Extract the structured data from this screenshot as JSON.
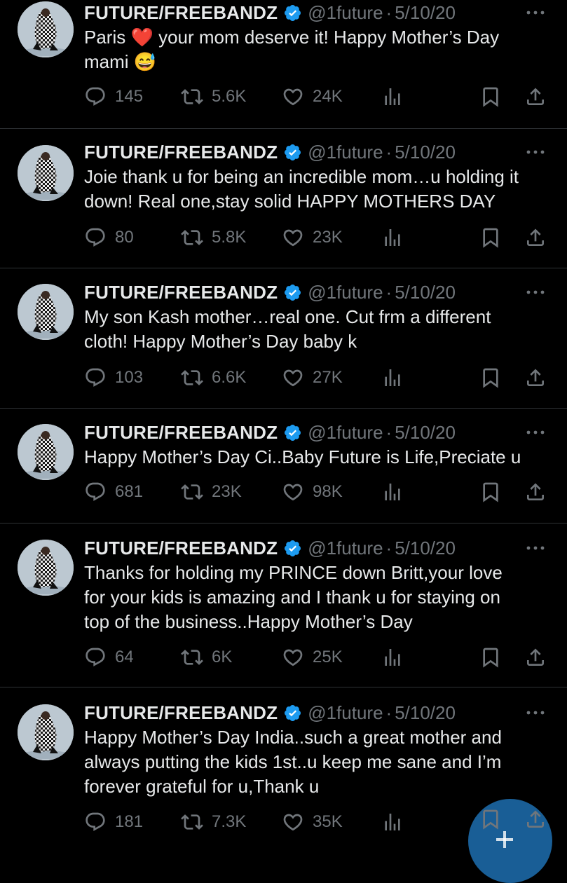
{
  "colors": {
    "background": "#000000",
    "text": "#e7e9ea",
    "muted": "#71767b",
    "verified": "#1d9bf0",
    "divider": "#2f3336",
    "fab": "#1d6fb0"
  },
  "tweets": [
    {
      "name": "FUTURE/FREEBANDZ",
      "handle": "@1future",
      "sep": "·",
      "date": "5/10/20",
      "lines": [
        "Paris",
        "mami"
      ],
      "paris_rest": " your mom deserve it! Happy Mother’s Day",
      "emoji_after_mami": "😅",
      "replies": "145",
      "reposts": "5.6K",
      "likes": "24K"
    },
    {
      "name": "FUTURE/FREEBANDZ",
      "handle": "@1future",
      "sep": "·",
      "date": "5/10/20",
      "lines": [
        "Joie thank u for being an incredible mom…u holding it",
        "down! Real one,stay solid HAPPY MOTHERS DAY"
      ],
      "replies": "80",
      "reposts": "5.8K",
      "likes": "23K"
    },
    {
      "name": "FUTURE/FREEBANDZ",
      "handle": "@1future",
      "sep": "·",
      "date": "5/10/20",
      "lines": [
        "My son Kash mother…real one. Cut frm a different",
        "cloth! Happy Mother’s Day baby k"
      ],
      "replies": "103",
      "reposts": "6.6K",
      "likes": "27K"
    },
    {
      "name": "FUTURE/FREEBANDZ",
      "handle": "@1future",
      "sep": "·",
      "date": "5/10/20",
      "lines": [
        "Happy Mother’s Day Ci..Baby Future is Life,Preciate u"
      ],
      "replies": "681",
      "reposts": "23K",
      "likes": "98K"
    },
    {
      "name": "FUTURE/FREEBANDZ",
      "handle": "@1future",
      "sep": "·",
      "date": "5/10/20",
      "lines": [
        "Thanks for holding my PRINCE down Britt,your love",
        "for your kids is amazing and I thank u for staying on",
        "top of the business..Happy Mother’s Day"
      ],
      "replies": "64",
      "reposts": "6K",
      "likes": "25K"
    },
    {
      "name": "FUTURE/FREEBANDZ",
      "handle": "@1future",
      "sep": "·",
      "date": "5/10/20",
      "lines": [
        "Happy Mother’s Day India..such a great mother and",
        "always putting the kids 1st..u keep me sane and I’m",
        "forever grateful for u,Thank u"
      ],
      "replies": "181",
      "reposts": "7.3K",
      "likes": "35K"
    }
  ]
}
